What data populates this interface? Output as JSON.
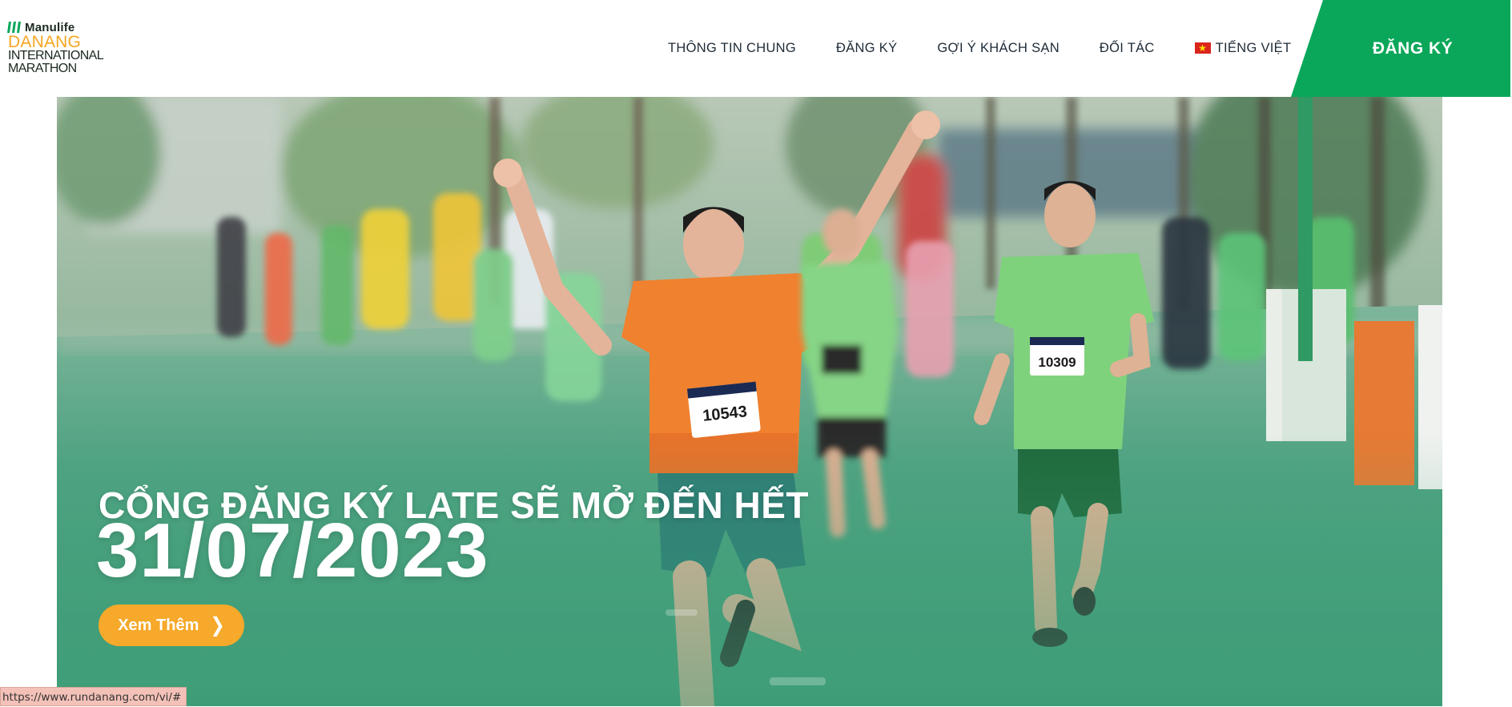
{
  "logo": {
    "brand": "Manulife",
    "line1": "DANANG",
    "line2": "INTERNATIONAL",
    "line3": "MARATHON",
    "icon": "manulife-bars-icon"
  },
  "nav": {
    "items": [
      {
        "label": "THÔNG TIN CHUNG"
      },
      {
        "label": "ĐĂNG KÝ"
      },
      {
        "label": "GỢI Ý KHÁCH SẠN"
      },
      {
        "label": "ĐỐI TÁC"
      }
    ],
    "language": {
      "label": "TIẾNG VIỆT",
      "icon": "vietnam-flag-icon"
    }
  },
  "register_button": "ĐĂNG KÝ",
  "hero": {
    "heading": "CỔNG ĐĂNG KÝ LATE SẼ MỞ ĐẾN HẾT",
    "date": "31/07/2023",
    "button_label": "Xem Thêm",
    "button_icon": "chevron-right-icon",
    "bibs": {
      "runner_center": "10543",
      "runner_right": "10309"
    }
  },
  "status_bar": {
    "url": "https://www.rundanang.com/vi/#"
  },
  "colors": {
    "brand_green": "#0aa75a",
    "accent_orange": "#f6a92a",
    "logo_orange": "#f5a623",
    "nav_text": "#1d2a36"
  }
}
